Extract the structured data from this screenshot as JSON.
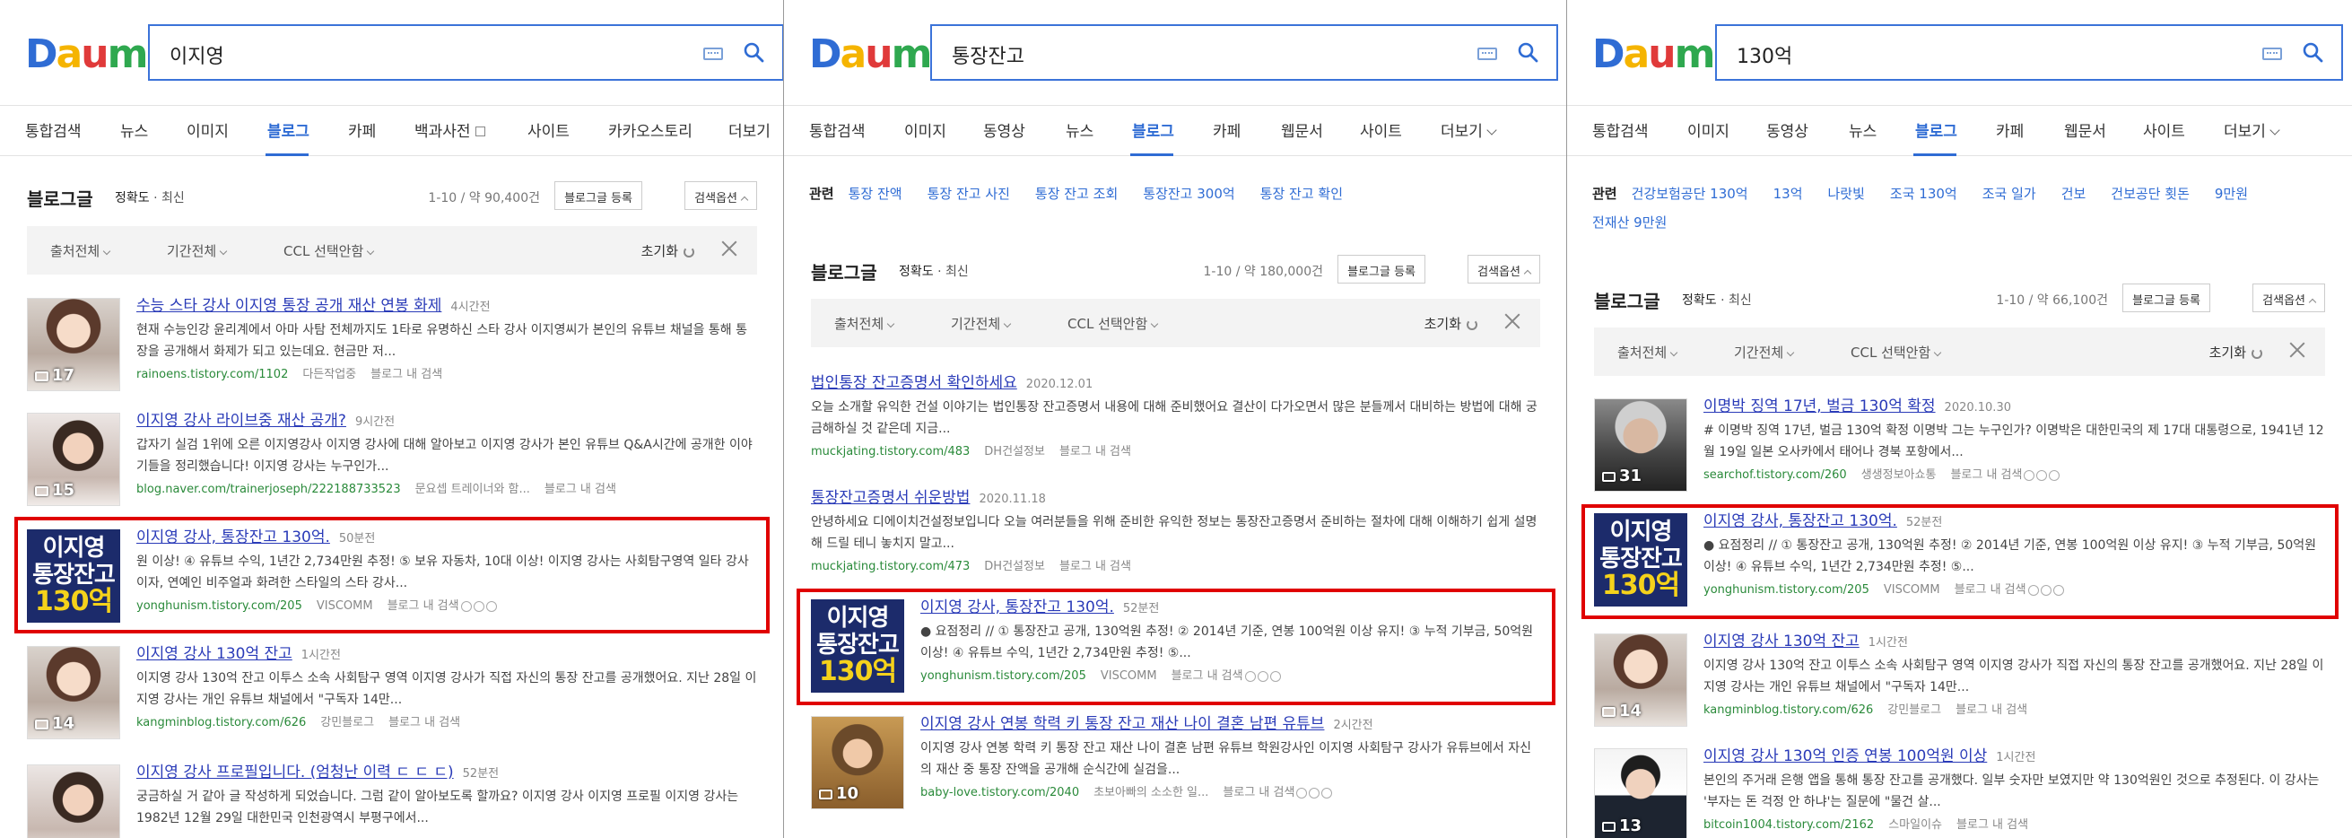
{
  "panels": [
    {
      "query": "이지영",
      "tabs": [
        "통합검색",
        "뉴스",
        "이미지",
        "블로그",
        "카페",
        "백과사전",
        "사이트",
        "카카오스토리",
        "더보기"
      ],
      "active_tab": "블로그",
      "blog": {
        "title": "블로그글",
        "sort_acc": "정확도",
        "sort_sep": "·",
        "sort_new": "최신",
        "count": "1-10 / 약 90,400건",
        "register": "블로그글 등록",
        "options": "검색옵션"
      },
      "filters": [
        "출처전체",
        "기간전체",
        "CCL 선택안함"
      ],
      "reset": "초기화",
      "results": [
        {
          "title": "수능 스타 강사 이지영 통장 공개 재산 연봉 화제",
          "time": "4시간전",
          "desc": "현재 수능인강 윤리계에서 아마 사탐 전체까지도 1타로 유명하신 스타 강사 이지영씨가 본인의 유튜브 채널을 통해 통장을 공개해서 화제가 되고 있는데요. 현금만 저...",
          "url": "rainoens.tistory.com/1102",
          "name": "다든작업중",
          "more": "블로그 내 검색",
          "thumb_count": "17"
        },
        {
          "title": "이지영 강사 라이브중 재산 공개?",
          "time": "9시간전",
          "desc": "갑자기 실검 1위에 오른 이지영강사 이지영 강사에 대해 알아보고 이지영 강사가 본인 유튜브 Q&A시간에 공개한 이야기들을 정리했습니다! 이지영 강사는 누구인가...",
          "url": "blog.naver.com/trainerjoseph/222188733523",
          "name": "문요셉 트레이너와 함...",
          "more": "블로그 내 검색",
          "thumb_count": "15"
        },
        {
          "title": "이지영 강사, 통장잔고 130억.",
          "time": "50분전",
          "desc": "원 이상! ④ 유튜브 수익, 1년간 2,734만원 추정! ⑤ 보유 자동차, 10대 이상! 이지영 강사는 사회탐구영역 일타 강사이자, 연예인 비주얼과 화려한 스타일의 스타 강사...",
          "url": "yonghunism.tistory.com/205",
          "name": "VISCOMM",
          "more": "블로그 내 검색"
        },
        {
          "title": "이지영 강사 130억 잔고",
          "time": "1시간전",
          "desc": "이지영 강사 130억 잔고 이투스 소속 사회탐구 영역 이지영 강사가 직접 자신의 통장 잔고를 공개했어요. 지난 28일 이지영 강사는 개인 유튜브 채널에서 \"구독자 14만...",
          "url": "kangminblog.tistory.com/626",
          "name": "강민블로그",
          "more": "블로그 내 검색",
          "thumb_count": "14"
        },
        {
          "title": "이지영 강사 프로필입니다. (엄청난 이력 ㄷ ㄷ ㄷ)",
          "time": "52분전",
          "desc": "궁금하실 거 같아 글 작성하게 되었습니다. 그럼 같이 알아보도록 할까요? 이지영 강사 이지영 프로필 이지영 강사는 1982년 12월 29일 대한민국 인천광역시 부평구에서...",
          "url": "",
          "name": "",
          "more": ""
        }
      ]
    },
    {
      "query": "통장잔고",
      "tabs": [
        "통합검색",
        "이미지",
        "동영상",
        "뉴스",
        "블로그",
        "카페",
        "웹문서",
        "사이트",
        "더보기"
      ],
      "active_tab": "블로그",
      "related_label": "관련",
      "related": [
        "통장 잔액",
        "통장 잔고 사진",
        "통장 잔고 조회",
        "통장잔고 300억",
        "통장 잔고 확인"
      ],
      "blog": {
        "title": "블로그글",
        "sort_acc": "정확도",
        "sort_sep": "·",
        "sort_new": "최신",
        "count": "1-10 / 약 180,000건",
        "register": "블로그글 등록",
        "options": "검색옵션"
      },
      "filters": [
        "출처전체",
        "기간전체",
        "CCL 선택안함"
      ],
      "reset": "초기화",
      "results": [
        {
          "title": "법인통장 잔고증명서 확인하세요",
          "time": "2020.12.01",
          "desc": "오늘 소개할 유익한 건설 이야기는 법인통장 잔고증명서 내용에 대해 준비했어요 결산이 다가오면서 많은 분들께서 대비하는 방법에 대해 궁금해하실 것 같은데 지금...",
          "url": "muckjating.tistory.com/483",
          "name": "DH건설정보",
          "more": "블로그 내 검색"
        },
        {
          "title": "통장잔고증명서 쉬운방법",
          "time": "2020.11.18",
          "desc": "안녕하세요 디에이치건설정보입니다 오늘 여러분들을 위해 준비한 유익한 정보는 통장잔고증명서 준비하는 절차에 대해 이해하기 쉽게 설명해 드릴 테니 놓치지 말고...",
          "url": "muckjating.tistory.com/473",
          "name": "DH건설정보",
          "more": "블로그 내 검색"
        },
        {
          "title": "이지영 강사, 통장잔고 130억.",
          "time": "52분전",
          "desc": "● 요점정리 // ① 통장잔고 공개, 130억원 추정! ② 2014년 기준, 연봉 100억원 이상 유지! ③ 누적 기부금, 50억원 이상! ④ 유튜브 수익, 1년간 2,734만원 추정! ⑤...",
          "url": "yonghunism.tistory.com/205",
          "name": "VISCOMM",
          "more": "블로그 내 검색"
        },
        {
          "title": "이지영 강사 연봉 학력 키 통장 잔고 재산 나이 결혼 남편 유튜브",
          "time": "2시간전",
          "desc": "이지영 강사 연봉 학력 키 통장 잔고 재산 나이 결혼 남편 유튜브 학원강사인 이지영 사회탐구 강사가 유튜브에서 자신의 재산 중 통장 잔액을 공개해 순식간에 실검을...",
          "url": "baby-love.tistory.com/2040",
          "name": "초보아빠의 소소한 일...",
          "more": "블로그 내 검색",
          "thumb_count": "10"
        }
      ]
    },
    {
      "query": "130억",
      "tabs": [
        "통합검색",
        "이미지",
        "동영상",
        "뉴스",
        "블로그",
        "카페",
        "웹문서",
        "사이트",
        "더보기"
      ],
      "active_tab": "블로그",
      "related_label": "관련",
      "related": [
        "건강보험공단 130억",
        "13억",
        "나랏빛",
        "조국 130억",
        "조국 일가",
        "건보",
        "건보공단 횟돈",
        "9만원",
        "전재산 9만원"
      ],
      "blog": {
        "title": "블로그글",
        "sort_acc": "정확도",
        "sort_sep": "·",
        "sort_new": "최신",
        "count": "1-10 / 약 66,100건",
        "register": "블로그글 등록",
        "options": "검색옵션"
      },
      "filters": [
        "출처전체",
        "기간전체",
        "CCL 선택안함"
      ],
      "reset": "초기화",
      "results": [
        {
          "title": "이명박 징역 17년, 벌금 130억 확정",
          "time": "2020.10.30",
          "desc": "# 이명박 징역 17년, 벌금 130억 확정 이명박 그는 누구인가? 이명박은 대한민국의 제 17대 대통령으로, 1941년 12월 19일 일본 오사카에서 태어나 경북 포항에서...",
          "url": "searchof.tistory.com/260",
          "name": "생생정보아쇼통",
          "more": "블로그 내 검색",
          "thumb_count": "31"
        },
        {
          "title": "이지영 강사, 통장잔고 130억.",
          "time": "52분전",
          "desc": "● 요점정리 // ① 통장잔고 공개, 130억원 추정! ② 2014년 기준, 연봉 100억원 이상 유지! ③ 누적 기부금, 50억원 이상! ④ 유튜브 수익, 1년간 2,734만원 추정! ⑤...",
          "url": "yonghunism.tistory.com/205",
          "name": "VISCOMM",
          "more": "블로그 내 검색"
        },
        {
          "title": "이지영 강사 130억 잔고",
          "time": "1시간전",
          "desc": "이지영 강사 130억 잔고 이투스 소속 사회탐구 영역 이지영 강사가 직접 자신의 통장 잔고를 공개했어요. 지난 28일 이지영 강사는 개인 유튜브 채널에서 \"구독자 14만...",
          "url": "kangminblog.tistory.com/626",
          "name": "강민블로그",
          "more": "블로그 내 검색",
          "thumb_count": "14"
        },
        {
          "title": "이지영 강사 130억 인증 연봉 100억원 이상",
          "time": "1시간전",
          "desc": "본인의 주거래 은행 앱을 통해 통장 잔고를 공개했다. 일부 숫자만 보였지만 약 130억원인 것으로 추정된다. 이 강사는 '부자는 돈 걱정 안 하냐'는 질문에 \"물건 살...",
          "url": "bitcoin1004.tistory.com/2162",
          "name": "스마일이슈",
          "more": "블로그 내 검색",
          "thumb_count": "13"
        }
      ]
    }
  ],
  "thumb_text": {
    "line1": "이지영",
    "line2": "통장잔고",
    "line3": "130억"
  },
  "highlight_color": "#e00000"
}
